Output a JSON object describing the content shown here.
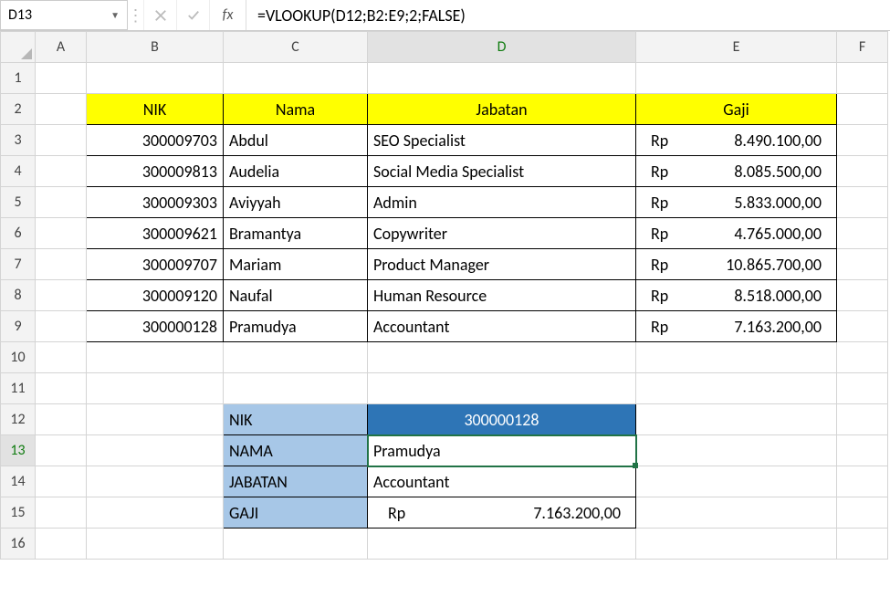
{
  "nameBox": "D13",
  "fxLabel": "fx",
  "formula": "=VLOOKUP(D12;B2:E9;2;FALSE)",
  "columns": [
    "A",
    "B",
    "C",
    "D",
    "E",
    "F"
  ],
  "rowCount": 16,
  "selectedCol": "D",
  "selectedRow": 13,
  "table": {
    "headers": {
      "nik": "NIK",
      "nama": "Nama",
      "jabatan": "Jabatan",
      "gaji": "Gaji"
    },
    "currency": "Rp",
    "rows": [
      {
        "nik": "300009703",
        "nama": "Abdul",
        "jabatan": "SEO Specialist",
        "gaji": "8.490.100,00"
      },
      {
        "nik": "300009813",
        "nama": "Audelia",
        "jabatan": "Social Media Specialist",
        "gaji": "8.085.500,00"
      },
      {
        "nik": "300009303",
        "nama": "Aviyyah",
        "jabatan": "Admin",
        "gaji": "5.833.000,00"
      },
      {
        "nik": "300009621",
        "nama": "Bramantya",
        "jabatan": "Copywriter",
        "gaji": "4.765.000,00"
      },
      {
        "nik": "300009707",
        "nama": "Mariam",
        "jabatan": "Product Manager",
        "gaji": "10.865.700,00"
      },
      {
        "nik": "300009120",
        "nama": "Naufal",
        "jabatan": "Human Resource",
        "gaji": "8.518.000,00"
      },
      {
        "nik": "300000128",
        "nama": "Pramudya",
        "jabatan": "Accountant",
        "gaji": "7.163.200,00"
      }
    ]
  },
  "lookup": {
    "labels": {
      "nik": "NIK",
      "nama": "NAMA",
      "jabatan": "JABATAN",
      "gaji": "GAJI"
    },
    "nik": "300000128",
    "nama": "Pramudya",
    "jabatan": "Accountant",
    "gaji_cur": "Rp",
    "gaji_val": "7.163.200,00"
  },
  "chart_data": {
    "type": "table",
    "title": "Employee data with VLOOKUP result",
    "columns": [
      "NIK",
      "Nama",
      "Jabatan",
      "Gaji"
    ],
    "rows": [
      [
        "300009703",
        "Abdul",
        "SEO Specialist",
        "Rp 8.490.100,00"
      ],
      [
        "300009813",
        "Audelia",
        "Social Media Specialist",
        "Rp 8.085.500,00"
      ],
      [
        "300009303",
        "Aviyyah",
        "Admin",
        "Rp 5.833.000,00"
      ],
      [
        "300009621",
        "Bramantya",
        "Copywriter",
        "Rp 4.765.000,00"
      ],
      [
        "300009707",
        "Mariam",
        "Product Manager",
        "Rp 10.865.700,00"
      ],
      [
        "300009120",
        "Naufal",
        "Human Resource",
        "Rp 8.518.000,00"
      ],
      [
        "300000128",
        "Pramudya",
        "Accountant",
        "Rp 7.163.200,00"
      ]
    ],
    "lookup_result": {
      "NIK": "300000128",
      "NAMA": "Pramudya",
      "JABATAN": "Accountant",
      "GAJI": "Rp 7.163.200,00"
    }
  }
}
